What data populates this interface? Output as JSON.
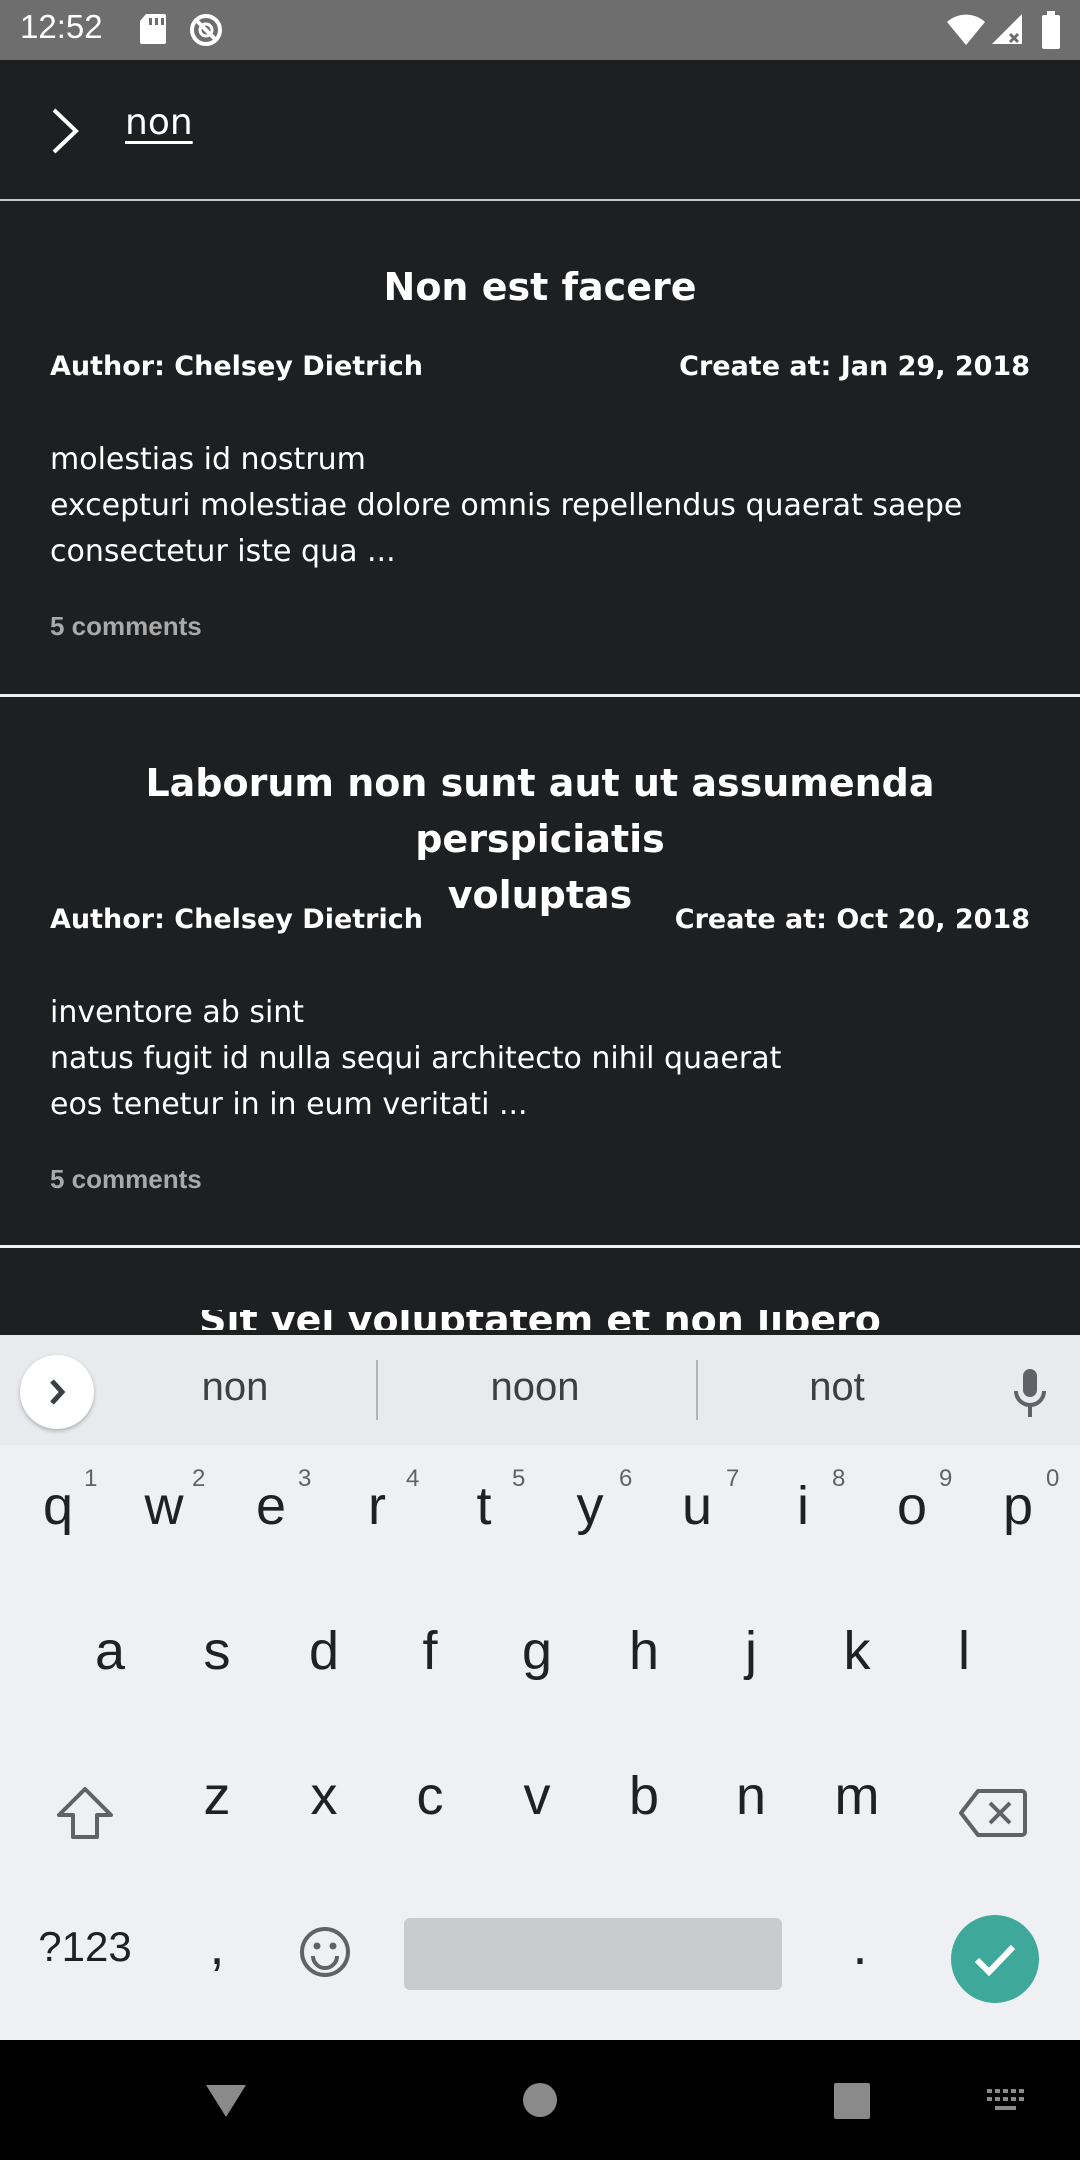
{
  "status_bar": {
    "time": "12:52"
  },
  "search": {
    "query": "non"
  },
  "posts": [
    {
      "title": "Non est facere",
      "author": "Author: Chelsey Dietrich",
      "created": "Create at: Jan 29, 2018",
      "body_lines": [
        "molestias id nostrum",
        "excepturi molestiae dolore omnis repellendus quaerat saepe",
        "consectetur iste qua ..."
      ],
      "comments": "5 comments"
    },
    {
      "title_lines": [
        "Laborum non sunt aut ut assumenda perspiciatis",
        "voluptas"
      ],
      "author": "Author: Chelsey Dietrich",
      "created": "Create at: Oct 20, 2018",
      "body_lines": [
        "inventore ab sint",
        "natus fugit id nulla sequi architecto nihil quaerat",
        "eos tenetur in in eum veritati ..."
      ],
      "comments": "5 comments"
    }
  ],
  "peek_title": "Sit vel voluptatem et non libero",
  "keyboard": {
    "suggestions": [
      "non",
      "noon",
      "not"
    ],
    "row1": [
      "q",
      "w",
      "e",
      "r",
      "t",
      "y",
      "u",
      "i",
      "o",
      "p"
    ],
    "row1_hints": [
      "1",
      "2",
      "3",
      "4",
      "5",
      "6",
      "7",
      "8",
      "9",
      "0"
    ],
    "row2": [
      "a",
      "s",
      "d",
      "f",
      "g",
      "h",
      "j",
      "k",
      "l"
    ],
    "row3": [
      "z",
      "x",
      "c",
      "v",
      "b",
      "n",
      "m"
    ],
    "symbols_key": "?123",
    "comma_key": ",",
    "period_key": "."
  },
  "icons": {
    "back": "chevron-right-icon",
    "mic": "microphone-icon",
    "shift": "shift-icon",
    "backspace": "backspace-icon",
    "emoji": "emoji-icon",
    "enter": "check-icon",
    "nav_back": "triangle-down-icon",
    "nav_home": "circle-icon",
    "nav_recents": "square-icon",
    "nav_keyboard": "keyboard-icon"
  },
  "colors": {
    "background": "#1e1f21",
    "status_bar": "#6e6e6e",
    "accent": "#3ea99a",
    "keyboard": "#eef0f3"
  }
}
